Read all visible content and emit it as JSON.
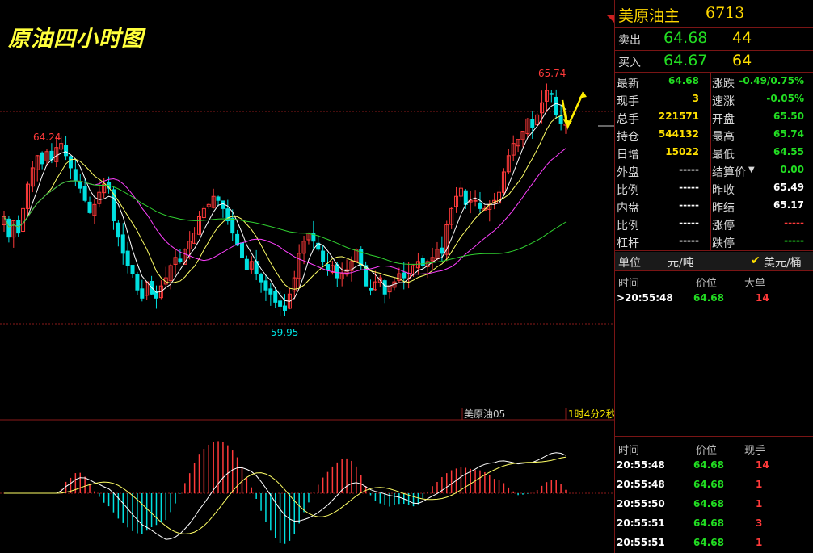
{
  "title": "原油四小时图",
  "chart": {
    "high_label": "65.74",
    "left_high_label": "64.24",
    "low_label": "59.95",
    "indicator_name": "美原油05",
    "countdown": "1时4分2秒"
  },
  "quote": {
    "name": "美原油主",
    "code": "6713",
    "sell_label": "卖出",
    "sell_price": "64.68",
    "sell_vol": "44",
    "buy_label": "买入",
    "buy_price": "64.67",
    "buy_vol": "64",
    "stats_left": [
      {
        "label": "最新",
        "value": "64.68",
        "color": "g"
      },
      {
        "label": "现手",
        "value": "3",
        "color": "y"
      },
      {
        "label": "总手",
        "value": "221571",
        "color": "y"
      },
      {
        "label": "持仓",
        "value": "544132",
        "color": "y"
      },
      {
        "label": "日增",
        "value": "15022",
        "color": "y"
      },
      {
        "label": "外盘",
        "value": "-----",
        "color": "w"
      },
      {
        "label": "比例",
        "value": "-----",
        "color": "w"
      },
      {
        "label": "内盘",
        "value": "-----",
        "color": "w"
      },
      {
        "label": "比例",
        "value": "-----",
        "color": "w"
      },
      {
        "label": "杠杆",
        "value": "-----",
        "color": "w"
      }
    ],
    "stats_right": [
      {
        "label": "涨跌",
        "value": "-0.49/0.75%",
        "color": "g"
      },
      {
        "label": "速涨",
        "value": "-0.05%",
        "color": "g"
      },
      {
        "label": "开盘",
        "value": "65.50",
        "color": "g"
      },
      {
        "label": "最高",
        "value": "65.74",
        "color": "g"
      },
      {
        "label": "最低",
        "value": "64.55",
        "color": "g"
      },
      {
        "label": "结算价",
        "value": "0.00",
        "color": "g"
      },
      {
        "label": "昨收",
        "value": "65.49",
        "color": "w"
      },
      {
        "label": "昨结",
        "value": "65.17",
        "color": "w"
      },
      {
        "label": "涨停",
        "value": "-----",
        "color": "r"
      },
      {
        "label": "跌停",
        "value": "-----",
        "color": "g"
      }
    ],
    "unit_label": "单位",
    "unit_value": "元/吨",
    "unit_alt": "美元/桶"
  },
  "ticks_top": {
    "headers": [
      "时间",
      "价位",
      "大单"
    ],
    "rows": [
      {
        "time": ">20:55:48",
        "price": "64.68",
        "vol": "14"
      }
    ]
  },
  "ticks_bottom": {
    "headers": [
      "时间",
      "价位",
      "现手"
    ],
    "rows": [
      {
        "time": "20:55:48",
        "price": "64.68",
        "vol": "14"
      },
      {
        "time": "20:55:48",
        "price": "64.68",
        "vol": "1"
      },
      {
        "time": "20:55:50",
        "price": "64.68",
        "vol": "1"
      },
      {
        "time": "20:55:51",
        "price": "64.68",
        "vol": "3"
      },
      {
        "time": "20:55:51",
        "price": "64.68",
        "vol": "1"
      }
    ]
  },
  "colors": {
    "up": "#ff3a3a",
    "down": "#00e0e0",
    "ma5": "#ffffff",
    "ma10": "#ffff66",
    "ma20": "#ff40ff",
    "ma60": "#30d030",
    "grid": "#8a1a1a",
    "arrow": "#ffee00"
  },
  "chart_data": {
    "type": "candlestick",
    "price_high": 65.74,
    "price_low": 59.95,
    "closes": [
      62.4,
      61.9,
      62.3,
      62.0,
      62.6,
      63.2,
      63.6,
      63.9,
      63.7,
      64.0,
      63.8,
      64.1,
      64.2,
      63.9,
      63.6,
      63.3,
      63.1,
      62.8,
      62.5,
      62.7,
      63.0,
      63.2,
      63.1,
      62.3,
      61.9,
      61.5,
      61.2,
      61.0,
      60.6,
      60.4,
      60.8,
      60.5,
      60.4,
      60.7,
      60.9,
      61.2,
      61.4,
      61.3,
      61.6,
      61.8,
      62.0,
      62.4,
      62.6,
      62.7,
      62.9,
      62.8,
      62.6,
      62.3,
      62.0,
      61.7,
      61.4,
      61.1,
      61.3,
      61.0,
      60.8,
      60.6,
      60.5,
      60.3,
      60.2,
      60.1,
      60.5,
      60.9,
      61.5,
      61.8,
      62.0,
      61.8,
      61.6,
      61.3,
      61.1,
      61.2,
      60.9,
      61.0,
      61.1,
      61.3,
      61.6,
      61.2,
      60.7,
      60.6,
      60.8,
      60.9,
      60.5,
      60.7,
      60.8,
      61.0,
      60.9,
      61.0,
      61.2,
      61.3,
      61.2,
      61.3,
      61.4,
      61.6,
      61.5,
      62.2,
      62.6,
      62.9,
      63.1,
      62.7,
      62.8,
      62.8,
      62.6,
      62.6,
      62.7,
      62.8,
      63.0,
      63.5,
      63.9,
      64.2,
      64.3,
      64.5,
      64.8,
      64.6,
      64.9,
      65.2,
      65.5,
      65.4,
      64.9,
      64.7,
      64.68
    ]
  }
}
